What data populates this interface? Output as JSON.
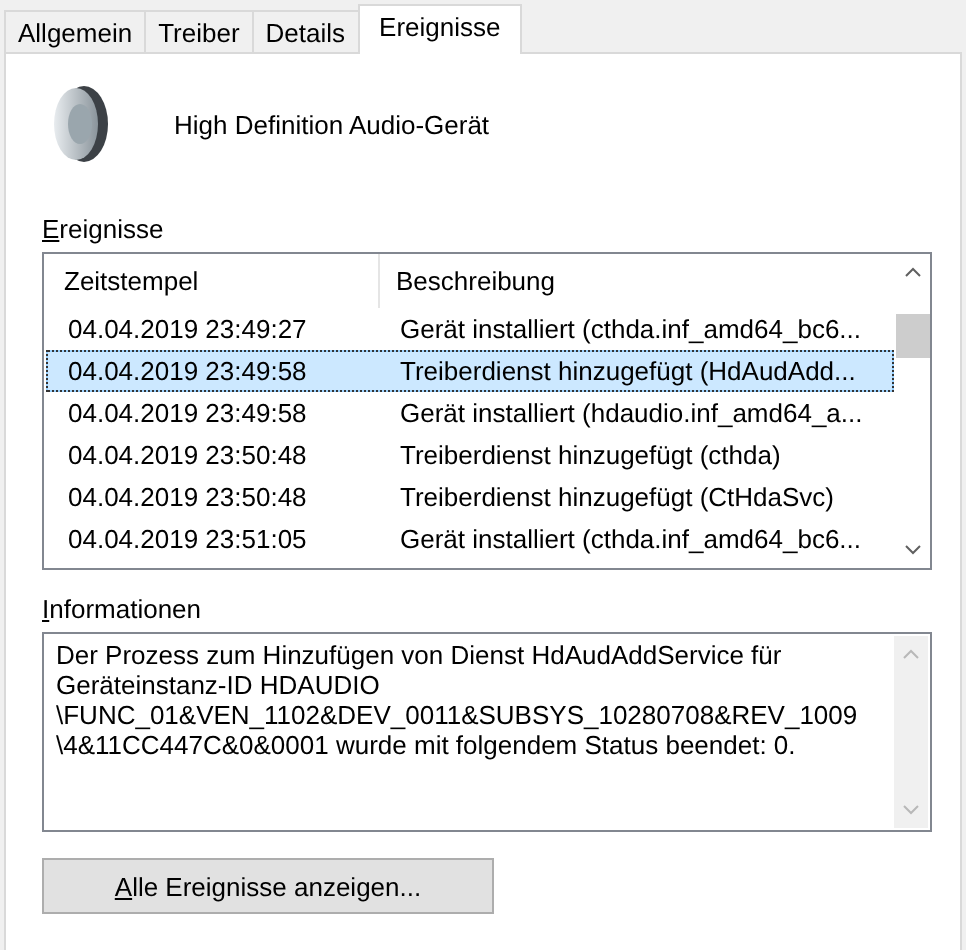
{
  "tabs": [
    {
      "label": "Allgemein",
      "selected": false
    },
    {
      "label": "Treiber",
      "selected": false
    },
    {
      "label": "Details",
      "selected": false
    },
    {
      "label": "Ereignisse",
      "selected": true
    }
  ],
  "device": {
    "name": "High Definition Audio-Gerät"
  },
  "events": {
    "label": "Ereignisse",
    "columns": [
      "Zeitstempel",
      "Beschreibung"
    ],
    "rows": [
      {
        "timestamp": "04.04.2019 23:49:27",
        "description": "Gerät installiert (cthda.inf_amd64_bc6...",
        "selected": false
      },
      {
        "timestamp": "04.04.2019 23:49:58",
        "description": "Treiberdienst hinzugefügt (HdAudAdd...",
        "selected": true
      },
      {
        "timestamp": "04.04.2019 23:49:58",
        "description": "Gerät installiert (hdaudio.inf_amd64_a...",
        "selected": false
      },
      {
        "timestamp": "04.04.2019 23:50:48",
        "description": "Treiberdienst hinzugefügt (cthda)",
        "selected": false
      },
      {
        "timestamp": "04.04.2019 23:50:48",
        "description": "Treiberdienst hinzugefügt (CtHdaSvc)",
        "selected": false
      },
      {
        "timestamp": "04.04.2019 23:51:05",
        "description": "Gerät installiert (cthda.inf_amd64_bc6...",
        "selected": false
      }
    ]
  },
  "information": {
    "label": "Informationen",
    "text": "Der Prozess zum Hinzufügen von Dienst HdAudAddService für\nGeräteinstanz-ID HDAUDIO\n\\FUNC_01&VEN_1102&DEV_0011&SUBSYS_10280708&REV_1009\n\\4&11CC447C&0&0001 wurde mit folgendem Status beendet: 0."
  },
  "buttons": [
    "Alle Ereignisse anzeigen..."
  ]
}
